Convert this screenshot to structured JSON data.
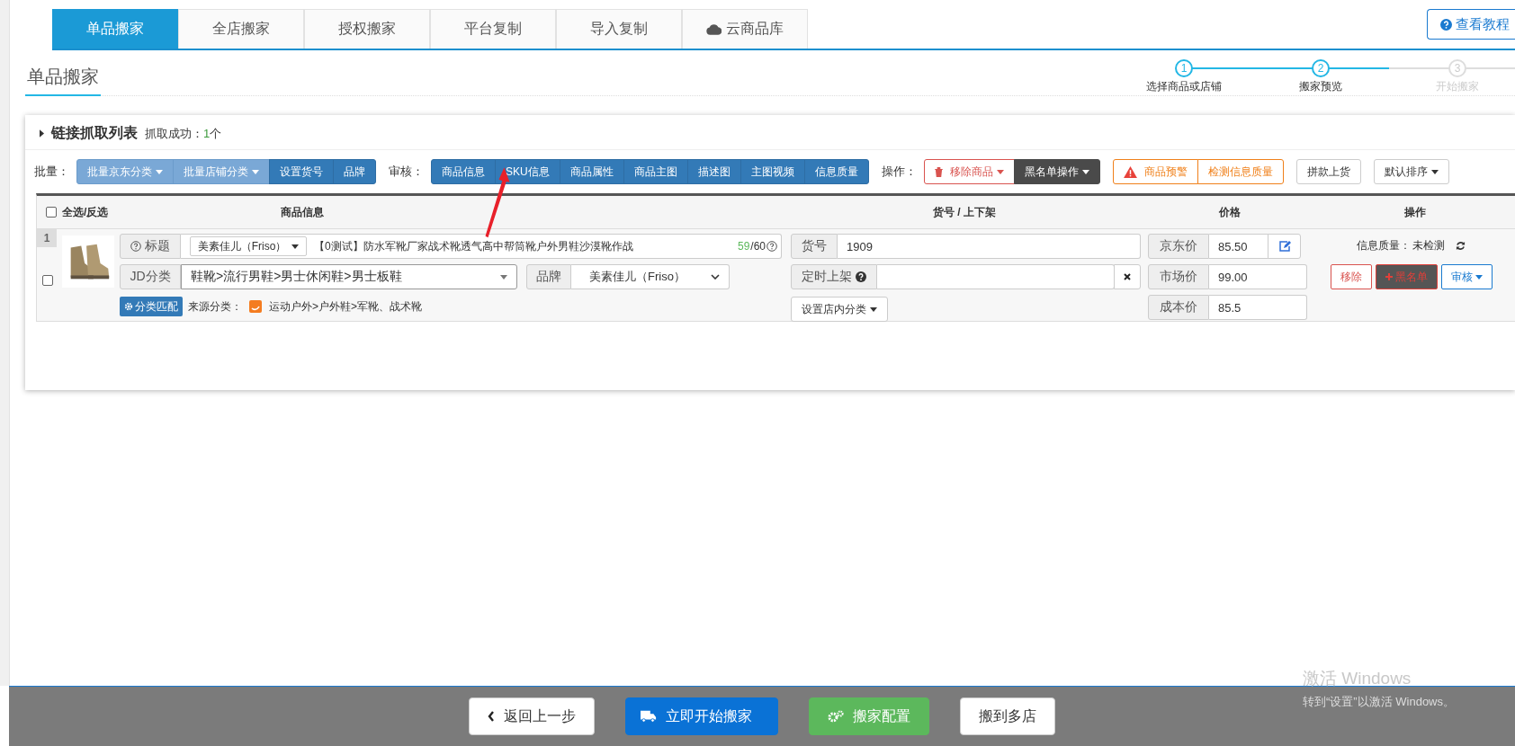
{
  "tabs": [
    {
      "label": "单品搬家",
      "selected": true,
      "has_icon": false
    },
    {
      "label": "全店搬家",
      "selected": false,
      "has_icon": false
    },
    {
      "label": "授权搬家",
      "selected": false,
      "has_icon": false
    },
    {
      "label": "平台复制",
      "selected": false,
      "has_icon": false
    },
    {
      "label": "导入复制",
      "selected": false,
      "has_icon": false
    },
    {
      "label": "云商品库",
      "selected": false,
      "has_icon": true
    }
  ],
  "help_button": "查看教程",
  "page_title": "单品搬家",
  "steps": [
    {
      "number": "1",
      "label": "选择商品或店铺",
      "done": true
    },
    {
      "number": "2",
      "label": "搬家预览",
      "done": true
    },
    {
      "number": "3",
      "label": "开始搬家",
      "done": false
    }
  ],
  "panel": {
    "title": "链接抓取列表",
    "status_label": "抓取成功：",
    "status_count": "1",
    "status_unit": "个"
  },
  "toolbar": [
    {
      "label": "批量：",
      "buttons": [
        {
          "label": "批量京东分类",
          "kind": "batch",
          "caret": true,
          "has_icon": false
        },
        {
          "label": "批量店铺分类",
          "kind": "batch",
          "caret": true,
          "has_icon": false
        },
        {
          "label": "设置货号",
          "kind": "primary",
          "caret": false,
          "has_icon": false
        },
        {
          "label": "品牌",
          "kind": "primary",
          "caret": false,
          "has_icon": false
        }
      ]
    },
    {
      "label": "审核：",
      "buttons": [
        {
          "label": "商品信息",
          "kind": "primary",
          "caret": false,
          "has_icon": false
        },
        {
          "label": "SKU信息",
          "kind": "primary",
          "caret": false,
          "has_icon": false
        },
        {
          "label": "商品属性",
          "kind": "primary",
          "caret": false,
          "has_icon": false
        },
        {
          "label": "商品主图",
          "kind": "primary",
          "caret": false,
          "has_icon": false
        },
        {
          "label": "描述图",
          "kind": "primary",
          "caret": false,
          "has_icon": false
        },
        {
          "label": "主图视频",
          "kind": "primary",
          "caret": false,
          "has_icon": false
        },
        {
          "label": "信息质量",
          "kind": "primary",
          "caret": false,
          "has_icon": false
        }
      ]
    },
    {
      "label": "操作：",
      "buttons": [
        {
          "label": "移除商品",
          "kind": "danger-outline",
          "caret": true,
          "has_icon": true
        },
        {
          "label": "黑名单操作",
          "kind": "dark",
          "caret": true,
          "has_icon": false
        }
      ]
    },
    {
      "buttons": [
        {
          "label": "商品预警",
          "kind": "warning-outline",
          "caret": false,
          "has_icon": true
        },
        {
          "label": "检测信息质量",
          "kind": "warning-outline",
          "caret": false,
          "has_icon": false
        }
      ]
    },
    {
      "buttons": [
        {
          "label": "拼款上货",
          "kind": "default",
          "caret": false,
          "has_icon": false
        }
      ]
    },
    {
      "buttons": [
        {
          "label": "默认排序",
          "kind": "default",
          "caret": true,
          "has_icon": false
        }
      ]
    }
  ],
  "table": {
    "select_all": {
      "label": "全选/反选",
      "checked": false
    },
    "columns": [
      "商品信息",
      "货号 / 上下架",
      "价格",
      "操作"
    ],
    "rows": [
      {
        "index": "1",
        "checked": false,
        "title_label": "标题",
        "shop_select": "美素佳儿（Friso）",
        "title": "【0测试】防水军靴厂家战术靴透气高中帮筒靴户外男鞋沙漠靴作战",
        "count_used": "59",
        "count_max": "/60",
        "jd_label": "JD分类",
        "jd_category": "鞋靴>流行男鞋>男士休闲鞋>男士板鞋",
        "brand_label": "品牌",
        "brand": "美素佳儿（Friso）",
        "match_button": "分类匹配",
        "source_label": "来源分类：",
        "source_category": "运动户外>户外鞋>军靴、战术靴",
        "sku_label": "货号",
        "sku": "1909",
        "schedule_label": "定时上架",
        "shop_category_button": "设置店内分类",
        "prices": [
          {
            "label": "京东价",
            "value": "85.50",
            "editable": true
          },
          {
            "label": "市场价",
            "value": "99.00",
            "editable": false
          },
          {
            "label": "成本价",
            "value": "85.5",
            "editable": false
          }
        ],
        "quality_label": "信息质量：",
        "quality_value": "未检测",
        "actions": [
          {
            "label": "移除",
            "kind": "danger-outline"
          },
          {
            "label": "黑名单",
            "kind": "blacklist"
          },
          {
            "label": "审核",
            "kind": "info-outline"
          }
        ]
      }
    ]
  },
  "footer_buttons": [
    {
      "label": "返回上一步",
      "kind": "back"
    },
    {
      "label": "立即开始搬家",
      "kind": "start"
    },
    {
      "label": "搬家配置",
      "kind": "config"
    },
    {
      "label": "搬到多店",
      "kind": "multi"
    }
  ],
  "os_notice": {
    "title": "激活 Windows",
    "hint": "转到“设置”以激活 Windows。"
  }
}
